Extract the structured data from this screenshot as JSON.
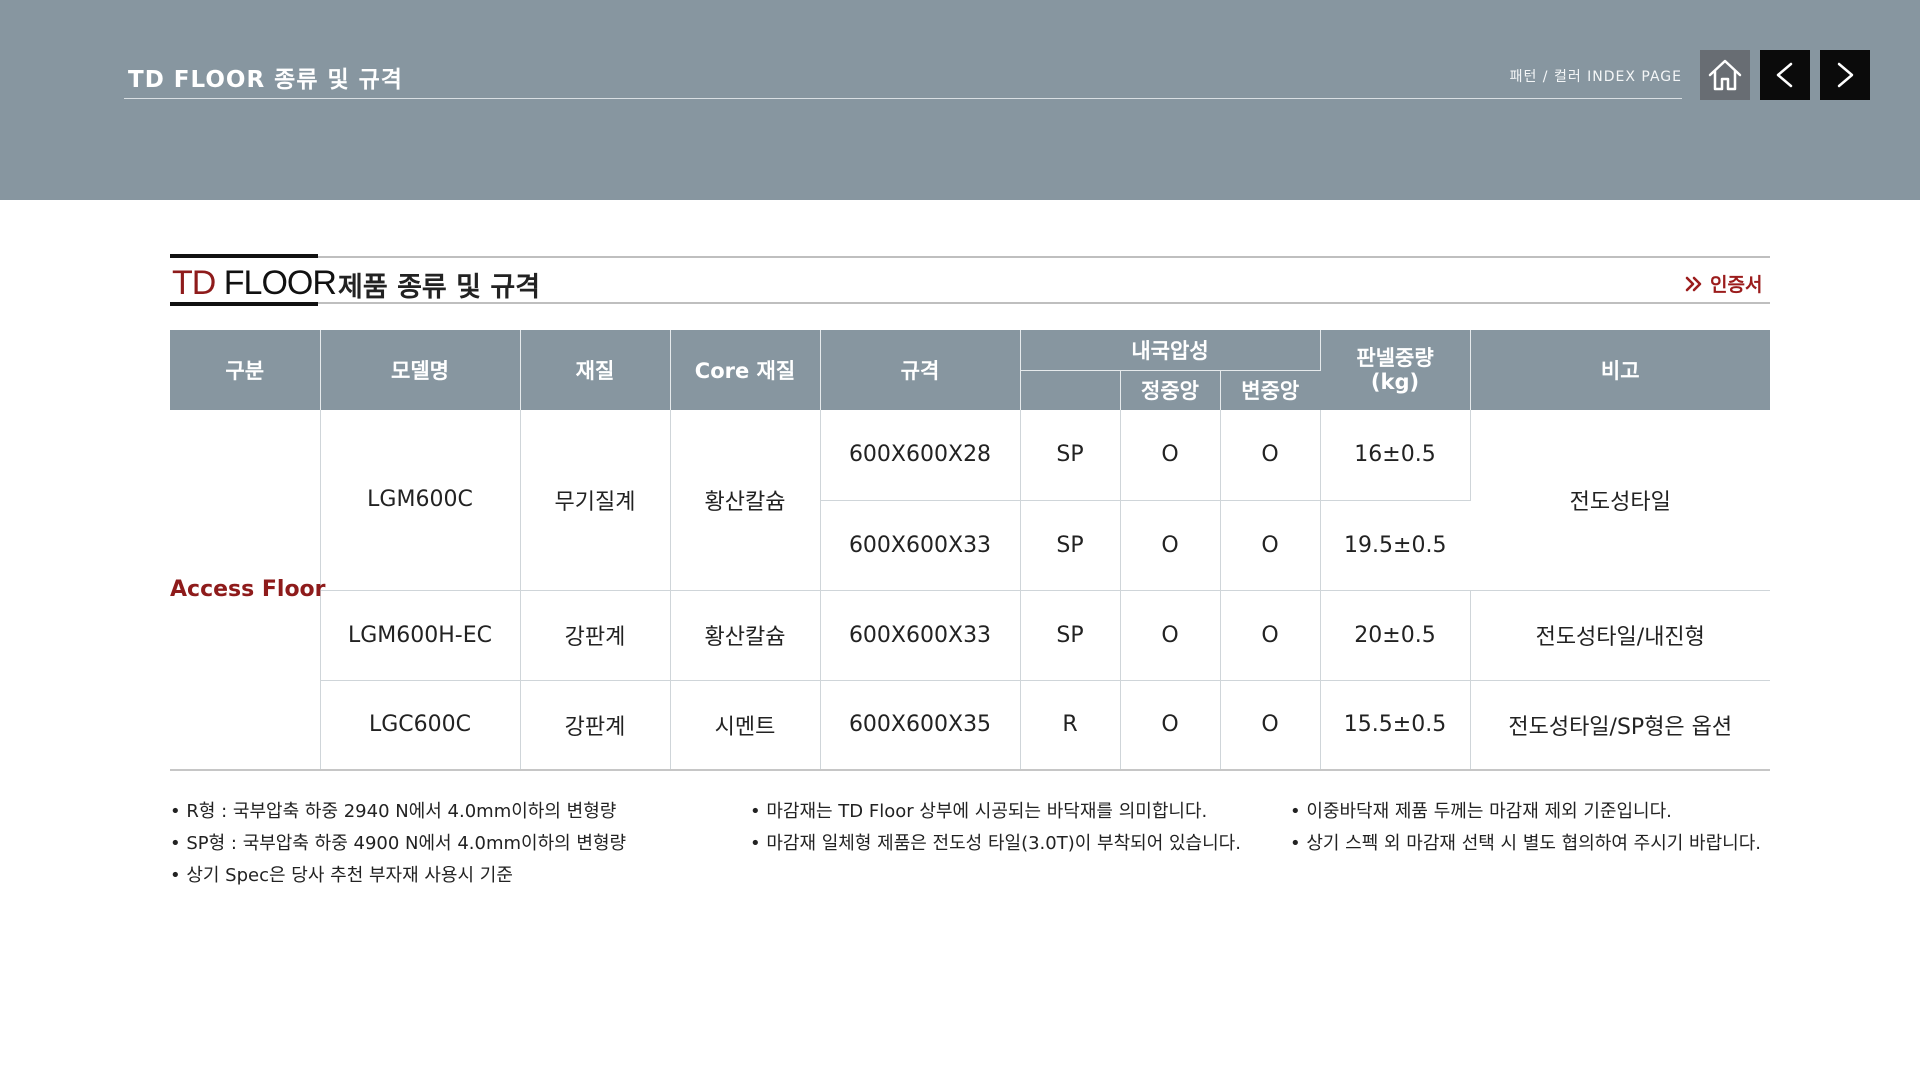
{
  "header": {
    "title": "TD FLOOR 종류 및 규격",
    "index_link": "패턴 / 컬러 INDEX PAGE",
    "home_icon": "home-icon",
    "prev_icon": "chevron-left-icon",
    "next_icon": "chevron-right-icon"
  },
  "section": {
    "brand_td": "TD",
    "brand_floor": " FLOOR",
    "subtitle": "제품 종류 및 규격",
    "cert_label": "인증서",
    "cert_color": "#9b1c1c"
  },
  "table": {
    "headers": {
      "category": "구분",
      "model": "모델명",
      "material": "재질",
      "core": "Core 재질",
      "size": "규격",
      "load": "내국압성",
      "static_load": "정중앙",
      "variable_load": "변중앙",
      "weight": "판넬중량\n(kg)",
      "remarks": "비고"
    },
    "category": "Access Floor",
    "rows": [
      {
        "model": "LGM600C",
        "material": "무기질계",
        "core": "황산칼슘",
        "size": "600X600X28",
        "type": "SP",
        "static": "O",
        "variable": "O",
        "weight": "16±0.5",
        "remarks": "전도성타일"
      },
      {
        "size": "600X600X33",
        "type": "SP",
        "static": "O",
        "variable": "O",
        "weight": "19.5±0.5"
      },
      {
        "model": "LGM600H-EC",
        "material": "강판계",
        "core": "황산칼슘",
        "size": "600X600X33",
        "type": "SP",
        "static": "O",
        "variable": "O",
        "weight": "20±0.5",
        "remarks": "전도성타일/내진형"
      },
      {
        "model": "LGC600C",
        "material": "강판계",
        "core": "시멘트",
        "size": "600X600X35",
        "type": "R",
        "static": "O",
        "variable": "O",
        "weight": "15.5±0.5",
        "remarks": "전도성타일/SP형은 옵션"
      }
    ]
  },
  "notes": {
    "col1": [
      "R형 : 국부압축 하중 2940 N에서 4.0mm이하의 변형량",
      "SP형 : 국부압축 하중 4900 N에서 4.0mm이하의 변형량",
      "상기 Spec은 당사 추천 부자재 사용시 기준"
    ],
    "col2": [
      "마감재는 TD Floor 상부에 시공되는 바닥재를 의미합니다.",
      "마감재 일체형 제품은 전도성 타일(3.0T)이 부착되어 있습니다."
    ],
    "col3": [
      "이중바닥재 제품 두께는 마감재 제외 기준입니다.",
      "상기 스펙 외 마감재 선택 시 별도 협의하여 주시기 바랍니다."
    ]
  },
  "colors": {
    "header_bg": "#8796a0",
    "accent_red": "#8e1b1b",
    "table_header_bg": "#8796a0"
  }
}
